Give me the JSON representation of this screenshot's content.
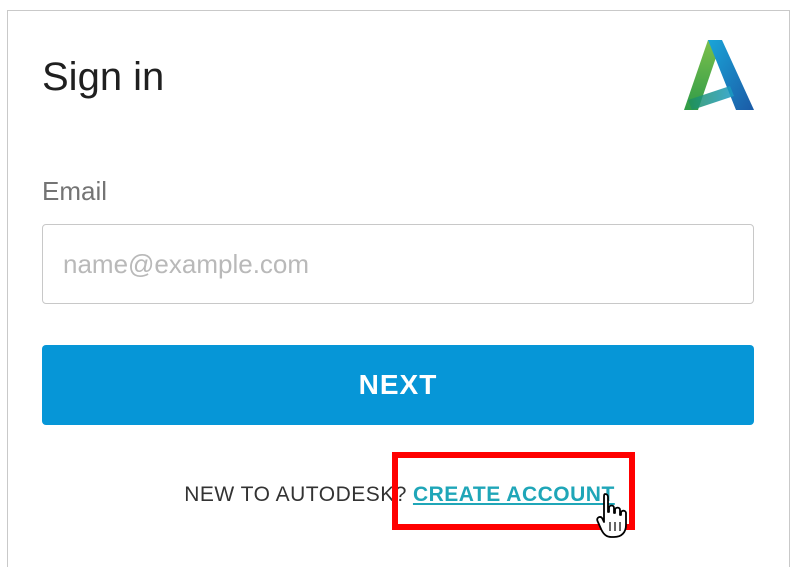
{
  "signin": {
    "title": "Sign in",
    "email_label": "Email",
    "email_placeholder": "name@example.com",
    "email_value": "",
    "next_label": "NEXT"
  },
  "footer": {
    "prompt": "NEW TO AUTODESK?",
    "create_account_label": "CREATE ACCOUNT"
  },
  "icons": {
    "logo": "autodesk-logo-icon",
    "cursor": "hand-pointer-cursor-icon"
  },
  "colors": {
    "primary_button": "#0696d7",
    "link": "#1fa6b8",
    "highlight": "#ff0000",
    "title_text": "#1f1f1f",
    "label_text": "#747474",
    "placeholder_text": "#b9b9b9"
  }
}
